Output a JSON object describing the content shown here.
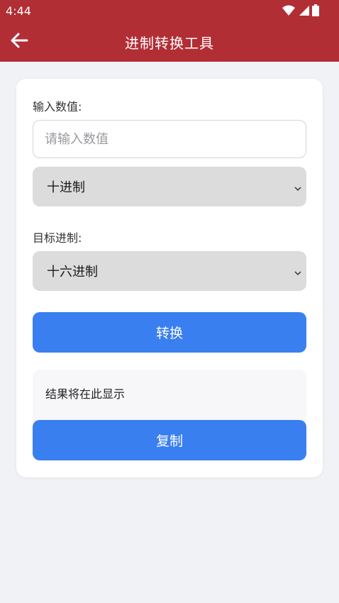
{
  "status_bar": {
    "time": "4:44",
    "icons": [
      "wifi-icon",
      "signal-icon",
      "battery-icon"
    ]
  },
  "app_bar": {
    "title": "进制转换工具",
    "back_icon": "arrow-left-icon"
  },
  "form": {
    "input_label": "输入数值:",
    "input_placeholder": "请输入数值",
    "input_value": "",
    "source_base": "十进制",
    "target_label": "目标进制:",
    "target_base": "十六进制",
    "convert_label": "转换",
    "result_placeholder": "结果将在此显示",
    "copy_label": "复制"
  },
  "colors": {
    "app_bar": "#b22e35",
    "primary_button": "#3a7ff0",
    "select_bg": "#dcdcdc",
    "page_bg": "#f1f2f6"
  }
}
